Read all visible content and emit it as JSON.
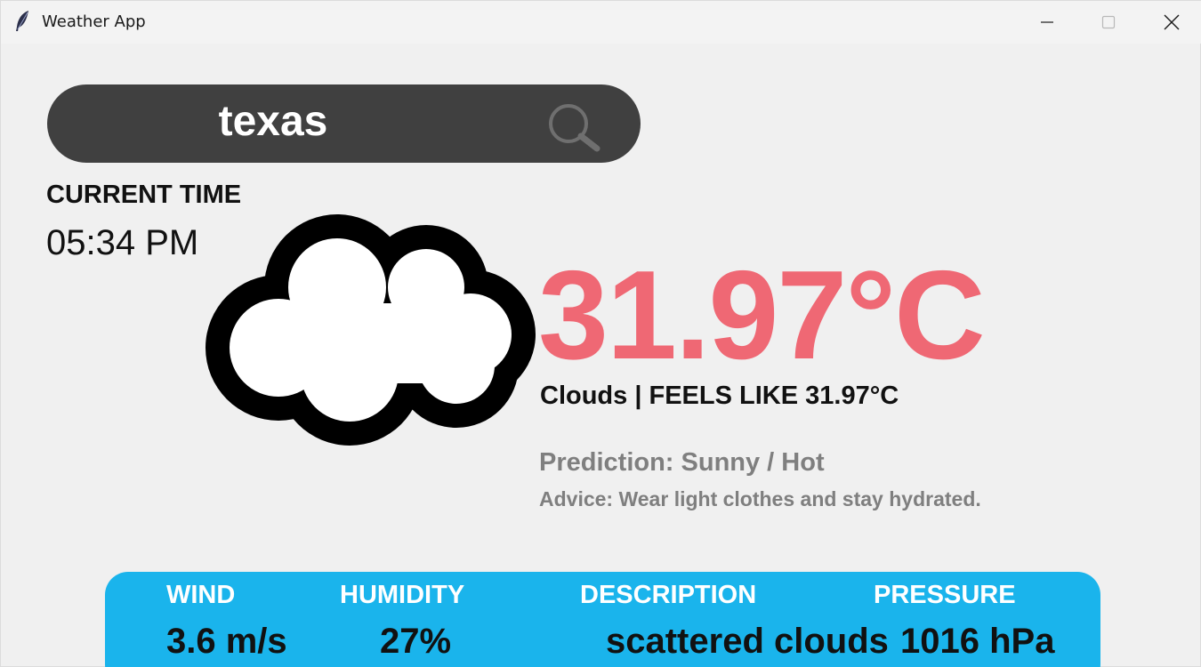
{
  "window": {
    "title": "Weather App",
    "icons": {
      "app": "feather-icon",
      "minimize": "minimize-icon",
      "maximize": "maximize-icon",
      "close": "close-icon"
    }
  },
  "search": {
    "value": "texas",
    "icon": "search-icon"
  },
  "clock": {
    "label": "CURRENT TIME",
    "value": "05:34 PM"
  },
  "weather": {
    "icon": "cloud-icon",
    "temperature": "31.97°C",
    "condition": "Clouds | FEELS LIKE 31.97°C",
    "prediction": "Prediction: Sunny / Hot",
    "advice": "Advice: Wear light clothes and stay hydrated."
  },
  "stats": {
    "wind_label": "WIND",
    "wind_value": "3.6 m/s",
    "humidity_label": "HUMIDITY",
    "humidity_value": "27%",
    "description_label": "DESCRIPTION",
    "description_value": "scattered clouds",
    "pressure_label": "PRESSURE",
    "pressure_value": "1016 hPa"
  },
  "colors": {
    "background": "#f0f0f0",
    "search_bar": "#404040",
    "temperature": "#ef6874",
    "muted_text": "#7f7f7f",
    "stats_panel": "#1ab4ec"
  }
}
